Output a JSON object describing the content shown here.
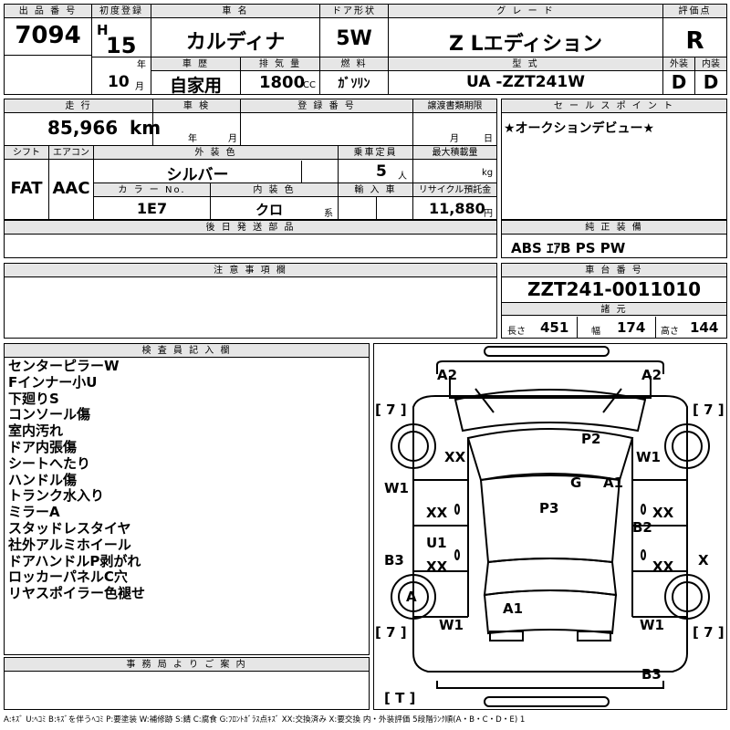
{
  "header": {
    "lot_no_label": "出 品 番 号",
    "lot_no": "7094",
    "first_reg_label": "初度登録",
    "era": "H",
    "year": "15",
    "year_unit": "年",
    "month": "10",
    "month_unit": "月",
    "car_name_label": "車 名",
    "car_name": "カルディナ",
    "door_label": "ドア形状",
    "door": "5W",
    "grade_label": "グ レ ー ド",
    "grade": "Z Lエディション",
    "score_label": "評価点",
    "score": "R",
    "history_label": "車 歴",
    "history": "自家用",
    "displacement_label": "排 気 量",
    "displacement": "1800",
    "displacement_unit": "CC",
    "fuel_label": "燃 料",
    "fuel": "ｶﾞｿﾘﾝ",
    "model_label": "型 式",
    "model": "UA -ZZT241W",
    "exterior_label": "外装",
    "exterior": "D",
    "interior_label": "内装",
    "interior": "D"
  },
  "row2": {
    "mileage_label": "走 行",
    "mileage": "85,966",
    "mileage_unit": "km",
    "inspection_label": "車 検",
    "insp_year_unit": "年",
    "insp_month_unit": "月",
    "reg_no_label": "登 録 番 号",
    "transfer_label": "譲渡書類期限",
    "transfer_month_unit": "月",
    "transfer_day_unit": "日",
    "shift_label": "シフト",
    "shift": "FAT",
    "ac_label": "エアコン",
    "ac": "AAC",
    "ext_color_label": "外 装 色",
    "ext_color": "シルバー",
    "capacity_label": "乗車定員",
    "capacity": "5",
    "capacity_unit": "人",
    "load_label": "最大積載量",
    "load_unit": "kg",
    "color_no_label": "カ ラ ー No.",
    "color_no": "1E7",
    "int_color_label": "内 装 色",
    "int_color": "クロ",
    "int_color_unit": "系",
    "import_label": "輸 入 車",
    "recycle_label": "リサイクル預託金",
    "recycle": "11,880",
    "recycle_unit": "円"
  },
  "sales_point": {
    "label": "セ ー ル ス ポ イ ン ト",
    "text": "★オークションデビュー★"
  },
  "later_parts": {
    "label": "後 日 発 送 部 品"
  },
  "equipment": {
    "label": "純 正 装 備",
    "text": "ABS ｴｱB PS PW"
  },
  "caution": {
    "label": "注 意 事 項 欄"
  },
  "chassis": {
    "label": "車 台 番 号",
    "number": "ZZT241-0011010",
    "spec_label": "諸 元",
    "length_label": "長さ",
    "length": "451",
    "width_label": "幅",
    "width": "174",
    "height_label": "高さ",
    "height": "144"
  },
  "inspector": {
    "label": "検 査 員 記 入 欄",
    "notes": [
      "センターピラーW",
      "Fインナー小U",
      "下廻りS",
      "コンソール傷",
      "室内汚れ",
      "ドア内張傷",
      "シートへたり",
      "ハンドル傷",
      "トランク水入り",
      "ミラーA",
      "スタッドレスタイヤ",
      "社外アルミホイール",
      "ドアハンドルP剥がれ",
      "ロッカーパネルC穴",
      "リヤスポイラー色褪せ"
    ]
  },
  "office": {
    "label": "事 務 局 よ り ご 案 内"
  },
  "diagram": {
    "marks": [
      "A2",
      "A2",
      "[ 7 ]",
      "[ 7 ]",
      "P2",
      "XX",
      "W1",
      "G",
      "A1",
      "W1",
      "XX",
      "P3",
      "XX",
      "B2",
      "U1",
      "B3",
      "XX",
      "XX",
      "X",
      "A",
      "A1",
      "[ 7 ]",
      "W1",
      "W1",
      "[ 7 ]",
      "B3",
      "[ T ]"
    ]
  },
  "legend": "A:ｷｽﾞ U:ﾍｺﾐ B:ｷｽﾞを伴うﾍｺﾐ P:要塗装 W:補修跡 S:錆 C:腐食 G:ﾌﾛﾝﾄｶﾞﾗｽ点ｷｽﾞ XX:交換済み X:要交換 内・外装評価 5段階ﾗﾝｸ順(A・B・C・D・E) 1"
}
